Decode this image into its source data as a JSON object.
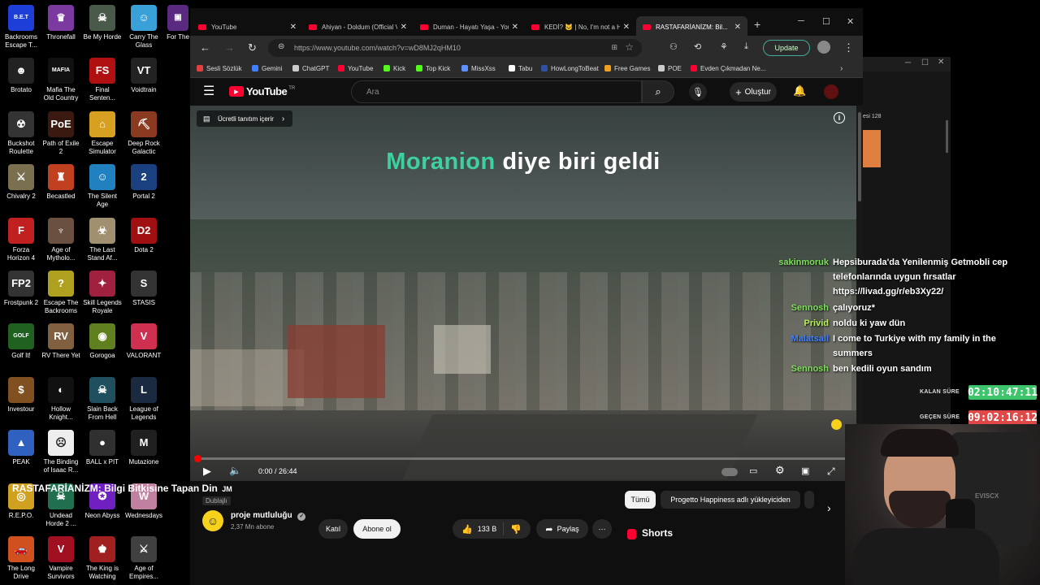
{
  "desktop_icons": [
    {
      "label": "Backrooms Escape T...",
      "color": "#1d3fd8",
      "glyph": "B.E.T"
    },
    {
      "label": "Thronefall",
      "color": "#7a3aa0",
      "glyph": "♛"
    },
    {
      "label": "Be My Horde",
      "color": "#4a5a4a",
      "glyph": "☠"
    },
    {
      "label": "Carry The Glass",
      "color": "#3aa0d8",
      "glyph": "☺"
    },
    {
      "label": "Brotato",
      "color": "#222222",
      "glyph": "☻"
    },
    {
      "label": "Mafia The Old Country",
      "color": "#111111",
      "glyph": "MAFIA"
    },
    {
      "label": "Final Senten...",
      "color": "#b01010",
      "glyph": "FS"
    },
    {
      "label": "Voidtrain",
      "color": "#222222",
      "glyph": "VT"
    },
    {
      "label": "Buckshot Roulette",
      "color": "#333333",
      "glyph": "☢"
    },
    {
      "label": "Path of Exile 2",
      "color": "#3a1a10",
      "glyph": "PoE"
    },
    {
      "label": "Escape Simulator",
      "color": "#d8a020",
      "glyph": "⌂"
    },
    {
      "label": "Deep Rock Galactic",
      "color": "#8a3a20",
      "glyph": "⛏"
    },
    {
      "label": "Chivalry 2",
      "color": "#7a7050",
      "glyph": "⚔"
    },
    {
      "label": "Becastled",
      "color": "#c04020",
      "glyph": "♜"
    },
    {
      "label": "The Silent Age",
      "color": "#2080c0",
      "glyph": "☺"
    },
    {
      "label": "Portal 2",
      "color": "#1a4080",
      "glyph": "2"
    },
    {
      "label": "Forza Horizon 4",
      "color": "#c02020",
      "glyph": "F"
    },
    {
      "label": "Age of Mytholo...",
      "color": "#6a5040",
      "glyph": "♆"
    },
    {
      "label": "The Last Stand Af...",
      "color": "#a09070",
      "glyph": "☣"
    },
    {
      "label": "Dota 2",
      "color": "#a01010",
      "glyph": "D2"
    },
    {
      "label": "Frostpunk 2",
      "color": "#333333",
      "glyph": "FP2"
    },
    {
      "label": "Escape The Backrooms",
      "color": "#b0a020",
      "glyph": "?"
    },
    {
      "label": "Skill Legends Royale",
      "color": "#a02040",
      "glyph": "✦"
    },
    {
      "label": "STASIS",
      "color": "#333333",
      "glyph": "S"
    },
    {
      "label": "Golf It!",
      "color": "#206020",
      "glyph": "GOLF"
    },
    {
      "label": "RV There Yet",
      "color": "#806040",
      "glyph": "RV"
    },
    {
      "label": "Gorogoa",
      "color": "#608020",
      "glyph": "◉"
    },
    {
      "label": "VALORANT",
      "color": "#d03050",
      "glyph": "V"
    },
    {
      "label": "Investour",
      "color": "#805020",
      "glyph": "$"
    },
    {
      "label": "Hollow Knight...",
      "color": "#111111",
      "glyph": "◐"
    },
    {
      "label": "Slain Back From Hell",
      "color": "#205060",
      "glyph": "☠"
    },
    {
      "label": "League of Legends",
      "color": "#1a2a40",
      "glyph": "L"
    },
    {
      "label": "PEAK",
      "color": "#3060c0",
      "glyph": "▲"
    },
    {
      "label": "The Binding of Isaac R...",
      "color": "#eeeeee",
      "glyph": "☹"
    },
    {
      "label": "BALL x PIT",
      "color": "#303030",
      "glyph": "●"
    },
    {
      "label": "Mutazione",
      "color": "#202020",
      "glyph": "M"
    },
    {
      "label": "R.E.P.O.",
      "color": "#d0a020",
      "glyph": "◎"
    },
    {
      "label": "Undead Horde 2 ...",
      "color": "#207050",
      "glyph": "☠"
    },
    {
      "label": "Neon Abyss",
      "color": "#7020c0",
      "glyph": "✪"
    },
    {
      "label": "Wednesdays",
      "color": "#c080a0",
      "glyph": "W"
    },
    {
      "label": "The Long Drive",
      "color": "#d05020",
      "glyph": "🚗"
    },
    {
      "label": "Vampire Survivors",
      "color": "#a01020",
      "glyph": "V"
    },
    {
      "label": "The King is Watching",
      "color": "#a02020",
      "glyph": "♚"
    },
    {
      "label": "Age of Empires...",
      "color": "#404040",
      "glyph": "⚔"
    }
  ],
  "partial_icon_label": "For The",
  "tabs": [
    {
      "title": "YouTube"
    },
    {
      "title": "Ahiyan - Doldum (Official V..."
    },
    {
      "title": "Duman - Hayatı Yaşa - You..."
    },
    {
      "title": "KEDİ? 🐱 | No, I'm not a Hu..."
    },
    {
      "title": "RASTAFARİANİZM: Bil..."
    }
  ],
  "address": {
    "url": "https://www.youtube.com/watch?v=wD8MJ2qHM10",
    "update_label": "Update"
  },
  "bookmarks": [
    {
      "label": "Sesli Sözlük",
      "color": "#e04040"
    },
    {
      "label": "Gemini",
      "color": "#4080ff"
    },
    {
      "label": "ChatGPT",
      "color": "#cccccc"
    },
    {
      "label": "YouTube",
      "color": "#ff0033"
    },
    {
      "label": "Kick",
      "color": "#53fc18"
    },
    {
      "label": "Top Kick",
      "color": "#53fc18"
    },
    {
      "label": "MissXss",
      "color": "#6090ff"
    },
    {
      "label": "Tabu",
      "color": "#ffffff"
    },
    {
      "label": "HowLongToBeat",
      "color": "#3050a0"
    },
    {
      "label": "Free Games",
      "color": "#f0a020"
    },
    {
      "label": "POE",
      "color": "#cccccc"
    },
    {
      "label": "Evden Çıkmadan Ne...",
      "color": "#ff0033"
    }
  ],
  "youtube": {
    "logo_text": "YouTube",
    "country": "TR",
    "search_placeholder": "Ara",
    "create_label": "Oluştur"
  },
  "video": {
    "promo_chip": "Ücretli tanıtım içerir",
    "caption_highlight": "Moranion",
    "caption_rest": "diye biri geldi",
    "time": "0:00 / 26:44",
    "progress": 0.0,
    "title": "RASTAFARİANİZM: Bilgi Bitkisine Tapan Din",
    "title_suffix": "JM",
    "dubbed_label": "Dublajlı",
    "channel_name": "proje mutluluğu",
    "subscribers": "2,37 Mn abone",
    "join_label": "Katıl",
    "subscribe_label": "Abone ol",
    "likes": "133 B",
    "share_label": "Paylaş"
  },
  "sidebar_chips": [
    "Tümü",
    "Progetto Happiness adlı yükleyiciden"
  ],
  "shorts_label": "Shorts",
  "chat": {
    "header_fragment": "esi 128",
    "messages": [
      {
        "user": "sakinmoruk",
        "user_color": "#7ee05a",
        "text": "Hepsiburada'da Yenilenmiş Getmobli cep telefonlarında uygun fırsatlar https://livad.gg/r/eb3Xy22/"
      },
      {
        "user": "Sennosh",
        "user_color": "#7ee05a",
        "text": "çalıyoruz*"
      },
      {
        "user": "Privid",
        "user_color": "#b8f060",
        "text": "noldu ki yaw dün"
      },
      {
        "user": "Malatsall",
        "user_color": "#4080ff",
        "text": "I come to Turkiye with my family in the summers"
      },
      {
        "user": "Sennosh",
        "user_color": "#7ee05a",
        "text": "ben kedili oyun sandım"
      }
    ]
  },
  "timers": {
    "remaining_label": "KALAN SÜRE",
    "remaining_value": "02:10:47:11",
    "remaining_color": "#3ec46a",
    "elapsed_label": "GEÇEN SÜRE",
    "elapsed_value": "09:02:16:12",
    "elapsed_color": "#e04848"
  },
  "webcam_text": "EVISCX"
}
